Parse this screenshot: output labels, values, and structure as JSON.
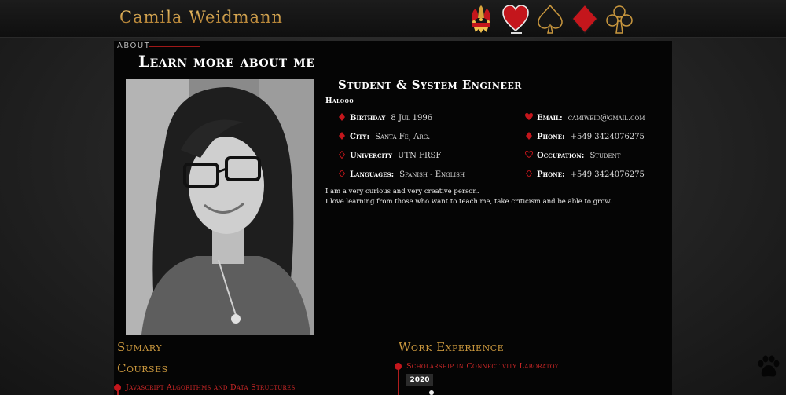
{
  "header": {
    "brand": "Camila Weidmann",
    "nav": [
      {
        "name": "joker-icon"
      },
      {
        "name": "heart-suit-icon"
      },
      {
        "name": "spade-suit-icon"
      },
      {
        "name": "diamond-suit-icon"
      },
      {
        "name": "club-suit-icon"
      }
    ]
  },
  "about": {
    "tag": "ABOUT",
    "title": "Learn more about me",
    "role": "Student & System Engineer",
    "greeting": "Halooo",
    "left_fields": [
      {
        "key": "Birthday",
        "value": "8 Jul 1996"
      },
      {
        "key": "City:",
        "value": "Santa Fe, Arg."
      },
      {
        "key": "Univercity",
        "value": "UTN FRSF"
      },
      {
        "key": "Languages:",
        "value": "Spanish - English"
      }
    ],
    "right_fields": [
      {
        "key": "Email:",
        "value": "camiweid@gmail.com"
      },
      {
        "key": "Phone:",
        "value": "+549 3424076275"
      },
      {
        "key": "Occupation:",
        "value": "Student"
      },
      {
        "key": "Phone:",
        "value": "+549 3424076275"
      }
    ],
    "bio": [
      "I am a very curious and very creative person.",
      "I love learning from those who want to teach me, take criticism and be able to grow."
    ]
  },
  "resume": {
    "summary_heading": "Sumary",
    "courses_heading": "Courses",
    "courses": [
      "Javascript Algorithms and Data Structures"
    ],
    "work_heading": "Work Experience",
    "work": [
      {
        "title": "Scholarship in Connectivity Laboratoy",
        "year": "2020"
      }
    ]
  },
  "colors": {
    "accent_gold": "#c9973e",
    "accent_red": "#c4161c",
    "panel_bg": "#050505"
  }
}
